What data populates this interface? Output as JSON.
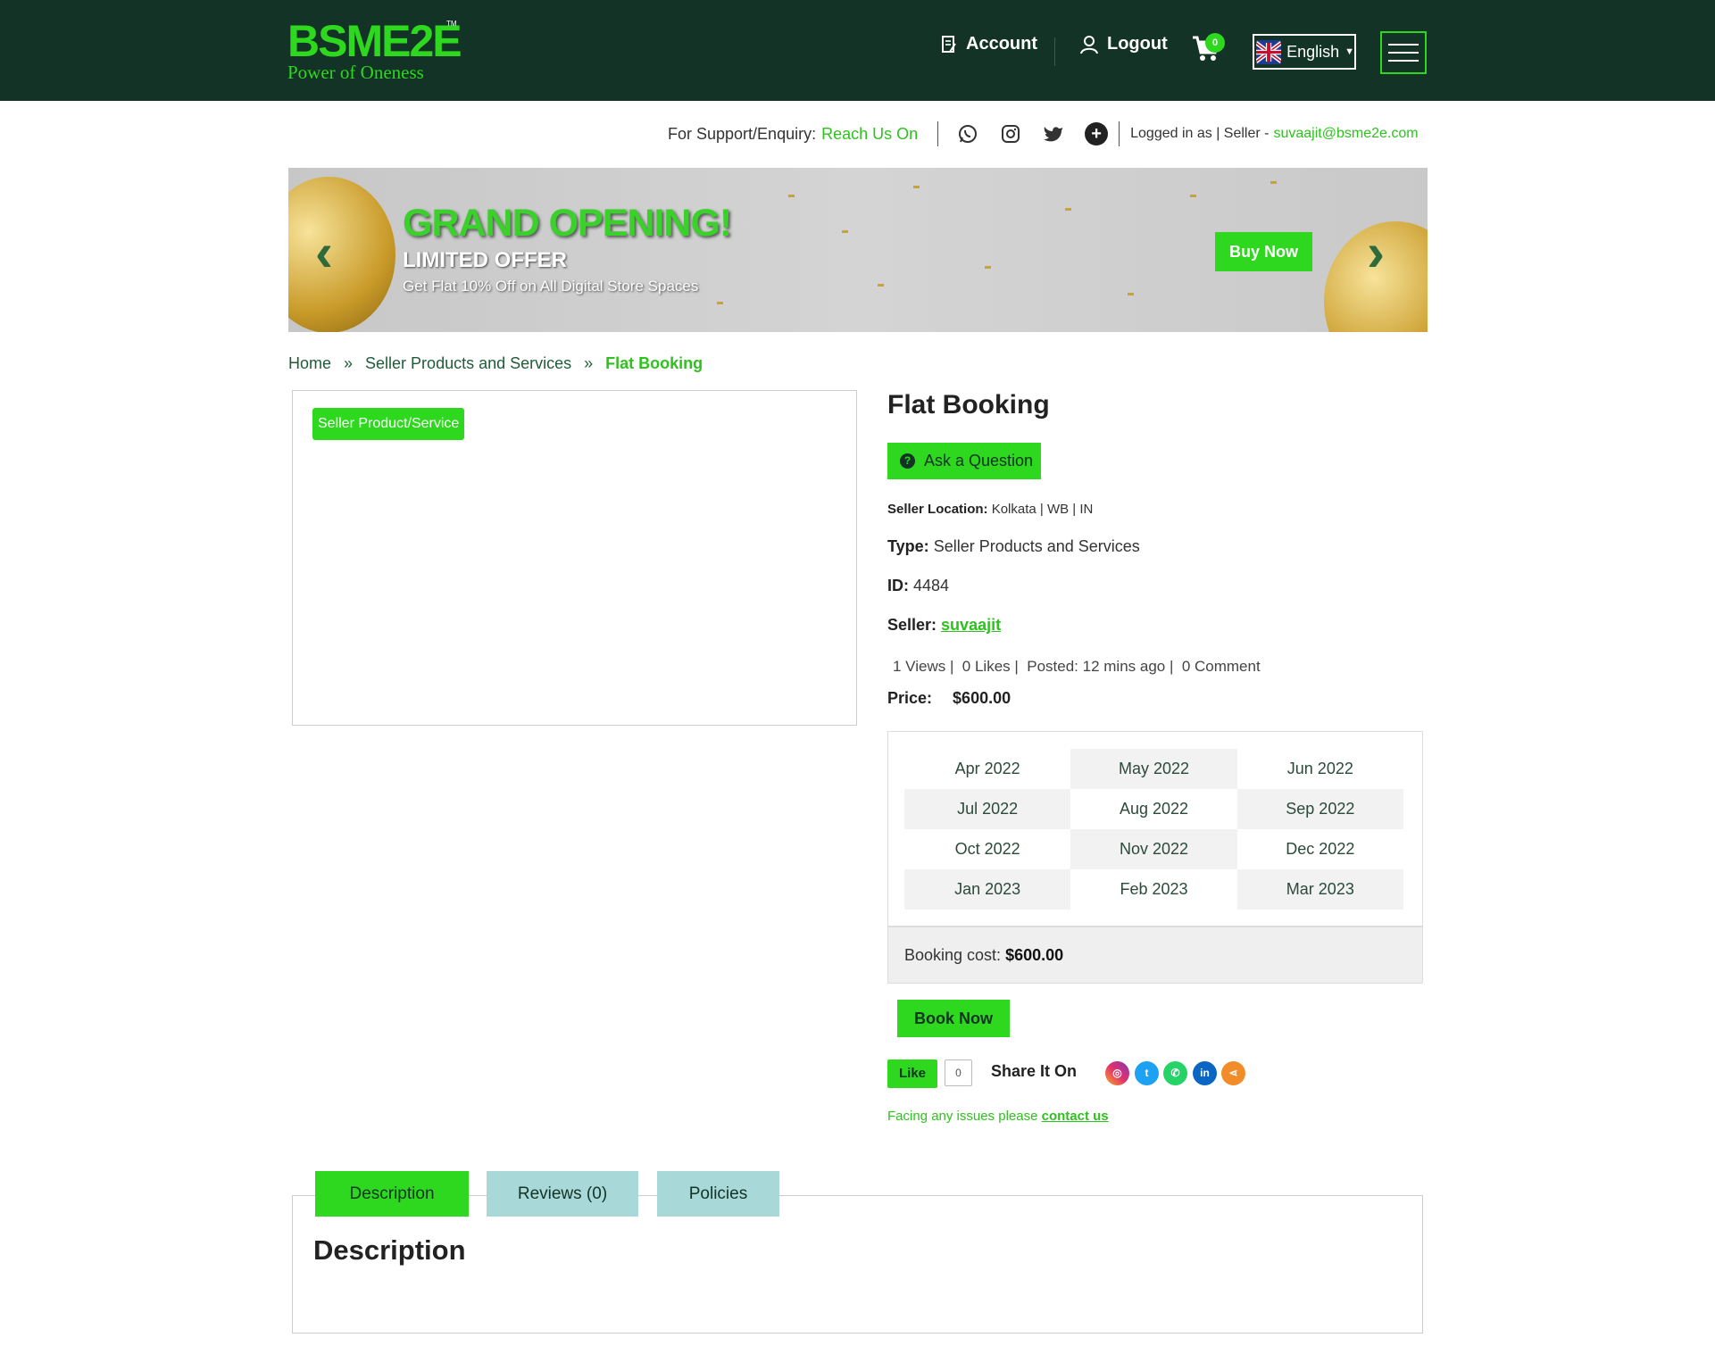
{
  "header": {
    "logo_main": "BSME2E",
    "logo_tm": "TM",
    "logo_tagline": "Power of Oneness",
    "account_label": "Account",
    "logout_label": "Logout",
    "cart_count": "0",
    "language": "English"
  },
  "support": {
    "label": "For Support/Enquiry:",
    "link": "Reach Us On",
    "logged_in_label": "Logged in as | Seller -",
    "email": "suvaajit@bsme2e.com"
  },
  "banner": {
    "headline": "GRAND OPENING!",
    "subheadline": "LIMITED OFFER",
    "text": "Get Flat 10% Off on All Digital Store Spaces",
    "button": "Buy Now"
  },
  "breadcrumb": {
    "home": "Home",
    "sep": "»",
    "category": "Seller Products and Services",
    "current": "Flat Booking"
  },
  "product": {
    "image_tag": "Seller Product/Service",
    "title": "Flat Booking",
    "ask_button": "Ask a Question",
    "location_label": "Seller Location:",
    "location": "Kolkata | WB | IN",
    "type_label": "Type:",
    "type": "Seller Products and Services",
    "id_label": "ID:",
    "id": "4484",
    "seller_label": "Seller:",
    "seller": "suvaajit",
    "stats": "1 Views |  0 Likes |  Posted: 12 mins ago |  0 Comment",
    "price_label": "Price:",
    "price": "$600.00"
  },
  "calendar": {
    "months": [
      "Apr 2022",
      "May 2022",
      "Jun 2022",
      "Jul 2022",
      "Aug 2022",
      "Sep 2022",
      "Oct 2022",
      "Nov 2022",
      "Dec 2022",
      "Jan 2023",
      "Feb 2023",
      "Mar 2023"
    ],
    "cost_label": "Booking cost:",
    "cost": "$600.00"
  },
  "actions": {
    "book_now": "Book Now",
    "like": "Like",
    "like_count": "0",
    "share_label": "Share It On",
    "issue_text": "Facing any issues please",
    "contact": "contact us"
  },
  "tabs": {
    "description": "Description",
    "reviews": "Reviews (0)",
    "policies": "Policies",
    "content_title": "Description"
  },
  "colors": {
    "brand_green": "#2ed81e",
    "header_bg": "#123326"
  }
}
